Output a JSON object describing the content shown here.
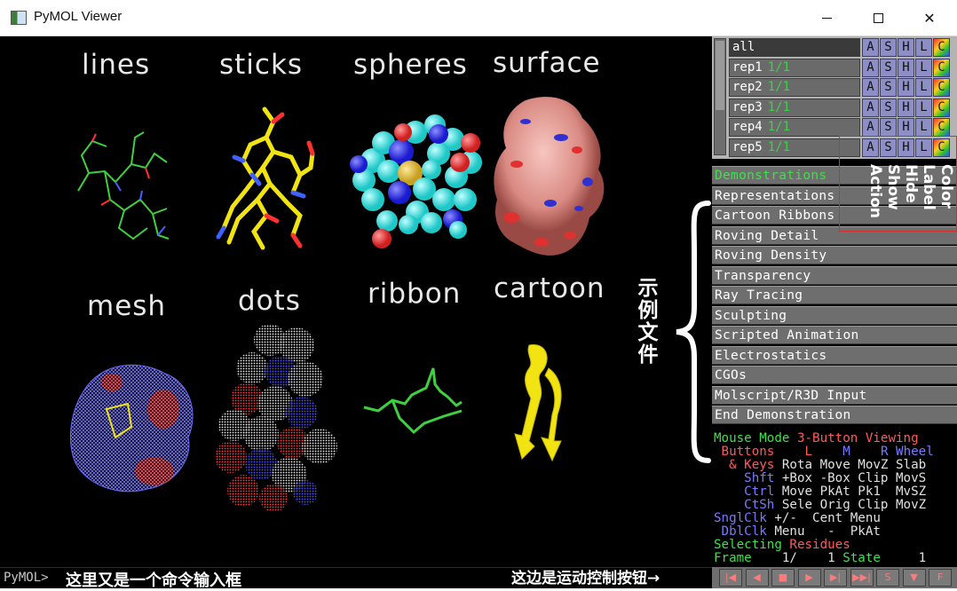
{
  "window": {
    "title": "PyMOL Viewer"
  },
  "viewer": {
    "labels": {
      "lines": "lines",
      "sticks": "sticks",
      "spheres": "spheres",
      "surface": "surface",
      "mesh": "mesh",
      "dots": "dots",
      "ribbon": "ribbon",
      "cartoon": "cartoon"
    }
  },
  "annotations": {
    "demo_files": "示例文件",
    "command_box": "这里又是一个命令输入框",
    "movie_controls": "这边是运动控制按钮→",
    "button_legend": [
      "Color",
      "Label",
      "Hide",
      "Show",
      "Action"
    ]
  },
  "command": {
    "prompt": "PyMOL>",
    "value": ""
  },
  "objects": [
    {
      "name": "all",
      "state": ""
    },
    {
      "name": "rep1",
      "state": "1/1"
    },
    {
      "name": "rep2",
      "state": "1/1"
    },
    {
      "name": "rep3",
      "state": "1/1"
    },
    {
      "name": "rep4",
      "state": "1/1"
    },
    {
      "name": "rep5",
      "state": "1/1"
    }
  ],
  "object_buttons": [
    "A",
    "S",
    "H",
    "L",
    "C"
  ],
  "wizard_buttons": [
    "Demonstrations",
    "Representations",
    "Cartoon Ribbons",
    "Roving Detail",
    "Roving Density",
    "Transparency",
    "Ray Tracing",
    "Sculpting",
    "Scripted Animation",
    "Electrostatics",
    "CGOs",
    "Molscript/R3D Input",
    "End Demonstration"
  ],
  "mouse": {
    "line1a": "Mouse Mode ",
    "line1b": "3-Button Viewing",
    "buttons_label": " Buttons",
    "btn_l": "L",
    "btn_m": "M",
    "btn_r": "R",
    "btn_wheel": "Wheel",
    "keys_label": "  & Keys",
    "keys_vals": " Rota Move MovZ Slab",
    "shft_label": "    Shft",
    "shft_vals": " +Box -Box Clip MovS",
    "ctrl_label": "    Ctrl",
    "ctrl_vals": " Move PkAt Pk1  MvSZ",
    "ctsh_label": "    CtSh",
    "ctsh_vals": " Sele Orig Clip MovZ",
    "sngl_label": "SnglClk",
    "sngl_vals": " +/-  Cent Menu",
    "dbl_label": " DblClk",
    "dbl_vals": " Menu   -  PkAt",
    "selecting_label": "Selecting ",
    "selecting_value": "Residues",
    "frame_label": "Frame",
    "frame_value": "    1/    1 ",
    "state_label": "State",
    "state_value": "     1"
  },
  "movie_buttons": [
    "|◀",
    "◀",
    "■",
    "▶",
    "▶|",
    "▶▶|",
    "S",
    "▼",
    "F"
  ],
  "colors": {
    "panel_gray": "#6e6e6e",
    "green_text": "#3fe04b",
    "red_text": "#ff5a5a",
    "blue_text": "#7a7aff",
    "annotation_box": "#d82b2b"
  }
}
